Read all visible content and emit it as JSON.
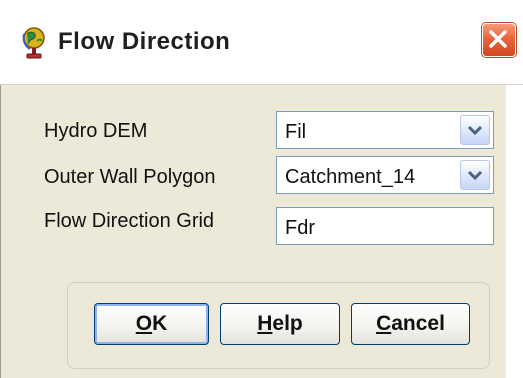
{
  "dialog": {
    "title": "Flow Direction",
    "icon": "globe-stand-icon",
    "close_icon": "close-x-icon"
  },
  "form": {
    "hydro_dem": {
      "label": "Hydro DEM",
      "value": "Fil",
      "type": "combo"
    },
    "outer_wall_polygon": {
      "label": "Outer Wall Polygon",
      "value": "Catchment_14",
      "type": "combo"
    },
    "flow_direction_grid": {
      "label": "Flow Direction Grid",
      "value": "Fdr",
      "type": "text"
    }
  },
  "buttons": {
    "ok": {
      "label": "OK",
      "mnemonic": "O",
      "rest": "K"
    },
    "help": {
      "label": "Help",
      "mnemonic": "H",
      "rest": "elp"
    },
    "cancel": {
      "label": "Cancel",
      "mnemonic": "C",
      "rest": "ancel"
    }
  },
  "colors": {
    "dialog_face": "#ece9d8",
    "field_border": "#7f9db9",
    "button_border": "#003c74",
    "close_button": "#e9653d"
  }
}
